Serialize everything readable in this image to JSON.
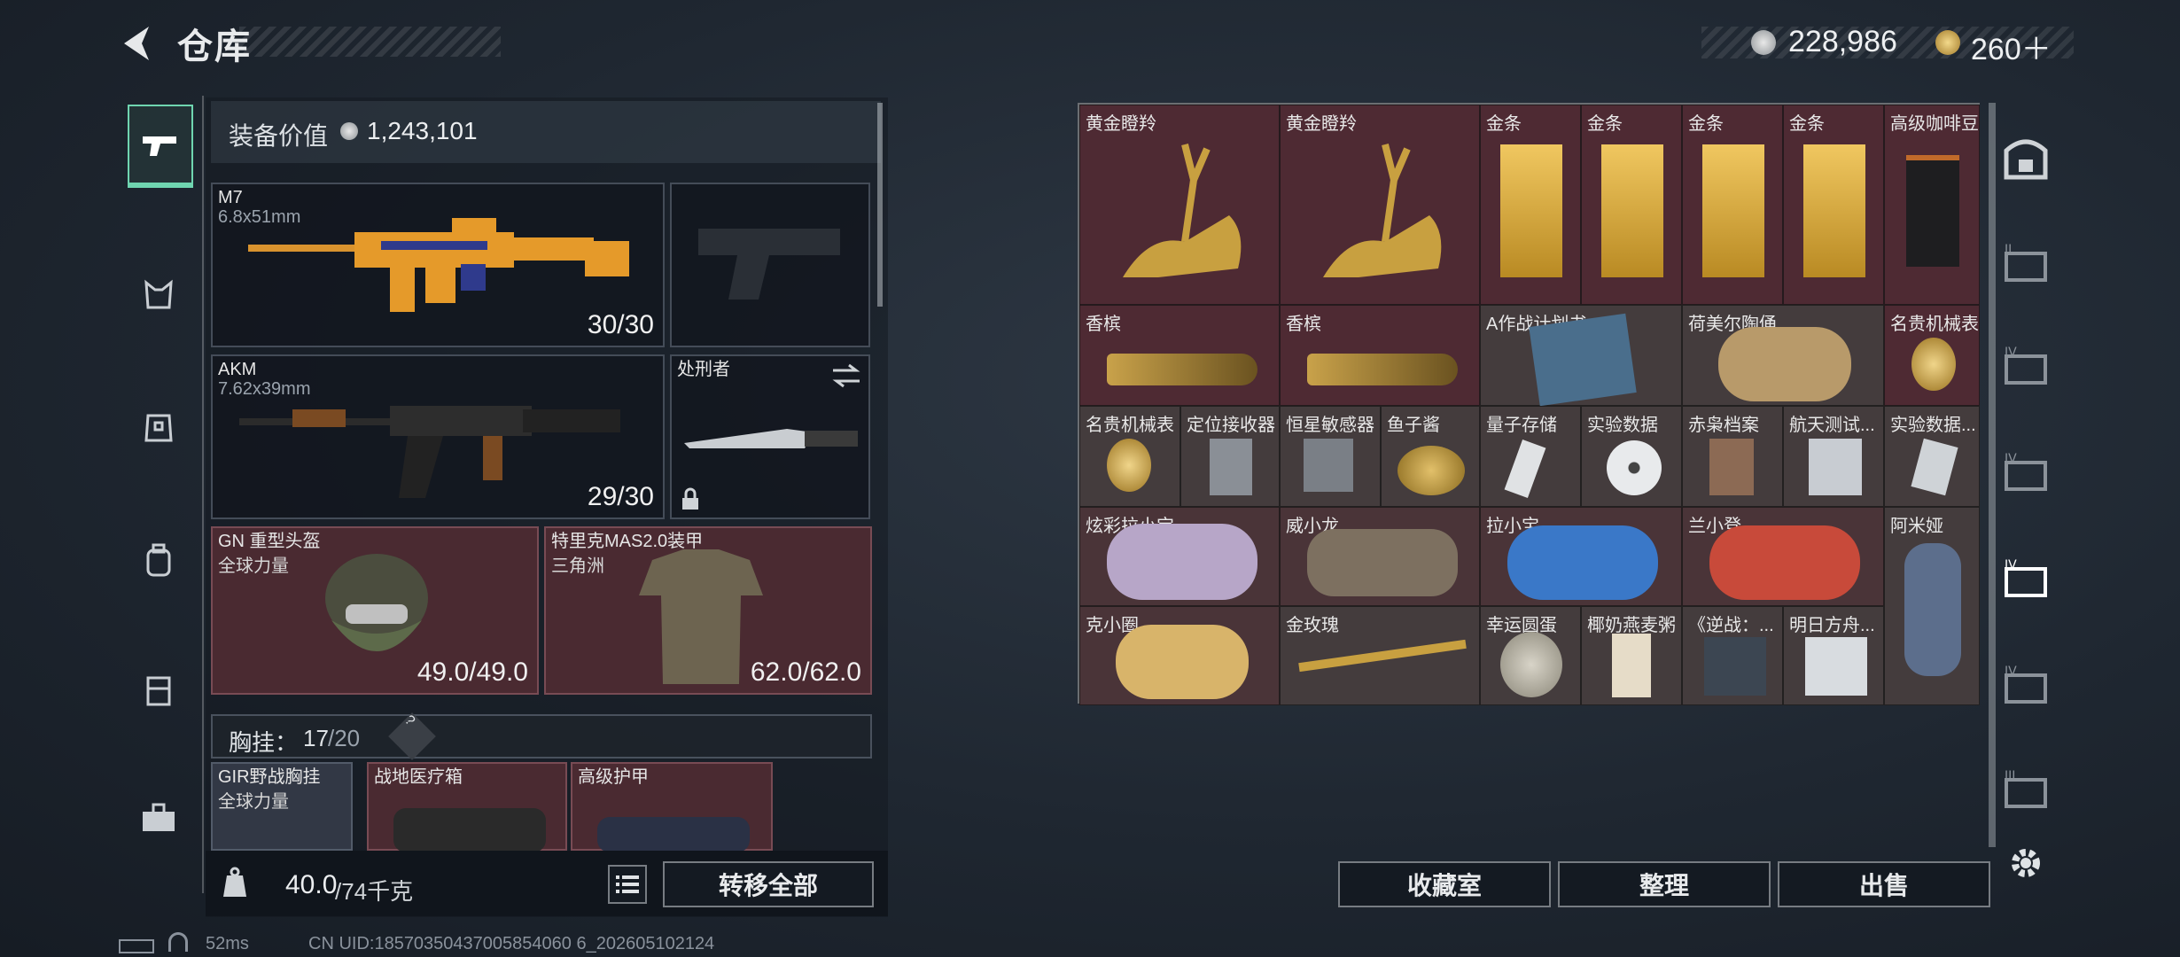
{
  "header": {
    "title": "仓库",
    "currency_silver": "228,986",
    "currency_gold": "260＋"
  },
  "left_rail": [
    "weapons-icon",
    "vest-icon",
    "armor-icon",
    "backpack-icon",
    "case-icon",
    "toolbox-icon"
  ],
  "equipment": {
    "value_label": "装备价值",
    "value": "1,243,101",
    "primary": {
      "name": "M7",
      "caliber": "6.8x51mm",
      "ammo": "30/30"
    },
    "secondary": {
      "name": "AKM",
      "caliber": "7.62x39mm",
      "ammo": "29/30"
    },
    "melee": {
      "name": "处刑者"
    },
    "helmet": {
      "name": "GN 重型头盔",
      "sub": "全球力量",
      "durability": "49.0/49.0"
    },
    "armor": {
      "name": "特里克MAS2.0装甲",
      "sub": "三角洲",
      "durability": "62.0/62.0"
    },
    "chestrig_label": "胸挂：",
    "chestrig_used": "17",
    "chestrig_total": "/20",
    "help": "?",
    "rig": {
      "name": "GIR野战胸挂",
      "sub": "全球力量"
    },
    "medkit": {
      "name": "战地医疗箱"
    },
    "armor2": {
      "name": "高级护甲"
    }
  },
  "weight": {
    "current": "40.0",
    "max": "/74千克"
  },
  "transfer_all": "转移全部",
  "stash": {
    "items": [
      "黄金瞪羚",
      "黄金瞪羚",
      "金条",
      "金条",
      "金条",
      "金条",
      "高级咖啡豆",
      "香槟",
      "香槟",
      "A作战计划书",
      "荷美尔陶俑",
      "名贵机械表",
      "名贵机械表",
      "定位接收器",
      "恒星敏感器",
      "鱼子酱",
      "量子存储",
      "实验数据",
      "赤枭档案",
      "航天测试...",
      "实验数据...",
      "炫彩拉小宝",
      "威小龙",
      "拉小宝",
      "兰小登",
      "阿米娅",
      "克小圈",
      "金玫瑰",
      "幸运圆蛋",
      "椰奶燕麦粥",
      "《逆战：...",
      "明日方舟..."
    ]
  },
  "actions": {
    "collection": "收藏室",
    "sort": "整理",
    "sell": "出售"
  },
  "right_rail": [
    "safe-box-icon",
    "tier-II-case-icon",
    "tier-IV-case-icon",
    "tier-IV-case-icon",
    "tier-IV-case-selected-icon",
    "tier-IV-case-icon",
    "tier-III-case-icon"
  ],
  "status": {
    "ping": "52ms",
    "uid": "CN UID:18570350437005854060 6_202605102124"
  }
}
